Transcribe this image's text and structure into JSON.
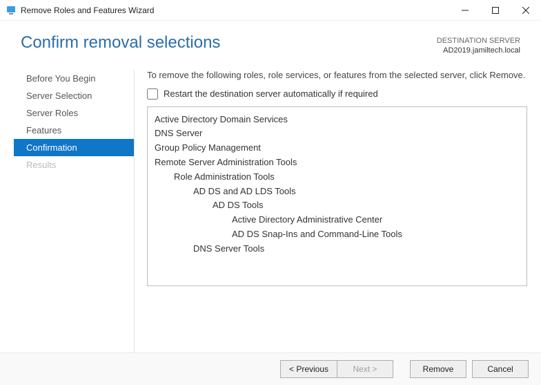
{
  "window": {
    "title": "Remove Roles and Features Wizard"
  },
  "header": {
    "heading": "Confirm removal selections",
    "dest_label": "DESTINATION SERVER",
    "dest_server": "AD2019.jamiltech.local"
  },
  "sidebar": {
    "items": [
      {
        "label": "Before You Begin",
        "state": "normal"
      },
      {
        "label": "Server Selection",
        "state": "normal"
      },
      {
        "label": "Server Roles",
        "state": "normal"
      },
      {
        "label": "Features",
        "state": "normal"
      },
      {
        "label": "Confirmation",
        "state": "active"
      },
      {
        "label": "Results",
        "state": "disabled"
      }
    ]
  },
  "main": {
    "instruction": "To remove the following roles, role services, or features from the selected server, click Remove.",
    "restart_checkbox_label": "Restart the destination server automatically if required",
    "restart_checked": false,
    "items": [
      {
        "text": "Active Directory Domain Services",
        "indent": 0
      },
      {
        "text": "DNS Server",
        "indent": 0
      },
      {
        "text": "Group Policy Management",
        "indent": 0
      },
      {
        "text": "Remote Server Administration Tools",
        "indent": 0
      },
      {
        "text": "Role Administration Tools",
        "indent": 1
      },
      {
        "text": "AD DS and AD LDS Tools",
        "indent": 2
      },
      {
        "text": "AD DS Tools",
        "indent": 3
      },
      {
        "text": "Active Directory Administrative Center",
        "indent": 4
      },
      {
        "text": "AD DS Snap-Ins and Command-Line Tools",
        "indent": 4
      },
      {
        "text": "DNS Server Tools",
        "indent": 2
      }
    ]
  },
  "footer": {
    "previous": "< Previous",
    "next": "Next >",
    "remove": "Remove",
    "cancel": "Cancel"
  }
}
